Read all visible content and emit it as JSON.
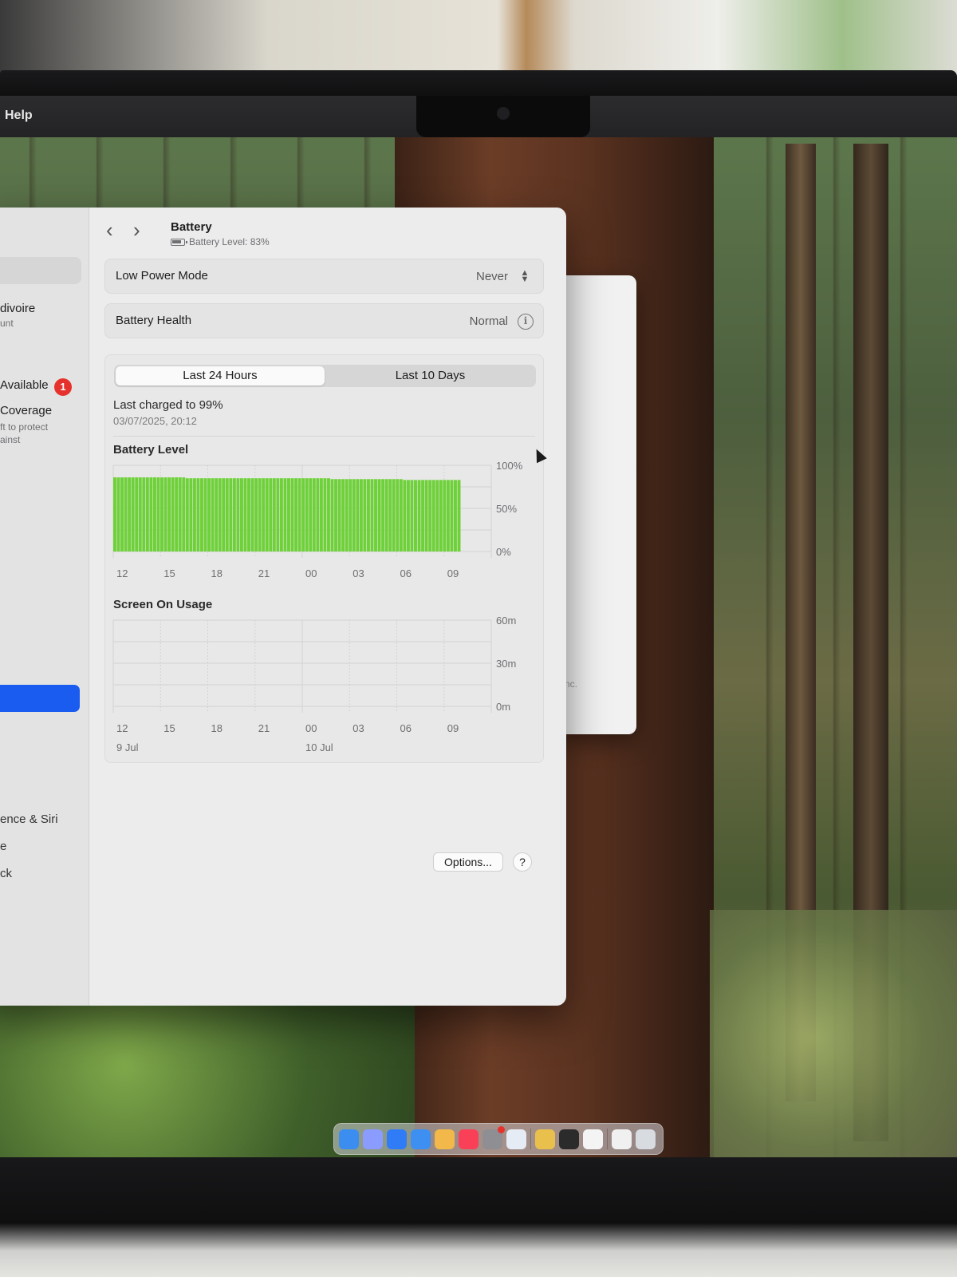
{
  "menubar": {
    "help_label": "Help"
  },
  "sidebar": {
    "items": [
      {
        "label": "divoire",
        "sub": "unt"
      },
      {
        "label": "Available",
        "badge": "1"
      },
      {
        "label": "Coverage",
        "sub1": "ft to protect",
        "sub2": "ainst"
      },
      {
        "label": "ence & Siri"
      },
      {
        "label": "e"
      },
      {
        "label": "ck"
      }
    ]
  },
  "header": {
    "back_icon": "chevron-left-icon",
    "forward_icon": "chevron-right-icon",
    "title": "Battery",
    "subtitle": "Battery Level: 83%"
  },
  "settings": {
    "low_power_mode": {
      "label": "Low Power Mode",
      "value": "Never"
    },
    "battery_health": {
      "label": "Battery Health",
      "value": "Normal"
    }
  },
  "range_tabs": {
    "tabs": [
      "Last 24 Hours",
      "Last 10 Days"
    ],
    "selected": "Last 24 Hours"
  },
  "last_charged": {
    "text": "Last charged to 99%",
    "date": "03/07/2025, 20:12"
  },
  "colors": {
    "battery_bar": "#6fd13a",
    "selected_sidebar": "#1a5cf0",
    "badge": "#e5322d"
  },
  "chart_data": [
    {
      "type": "bar",
      "title": "Battery Level",
      "x_ticks": [
        "12",
        "15",
        "18",
        "21",
        "00",
        "03",
        "06",
        "09"
      ],
      "y_ticks": [
        "100%",
        "50%",
        "0%"
      ],
      "ylim": [
        0,
        100
      ],
      "grid": true,
      "values": [
        86,
        86,
        86,
        86,
        86,
        86,
        86,
        86,
        86,
        86,
        86,
        86,
        86,
        86,
        86,
        86,
        86,
        86,
        86,
        86,
        85,
        85,
        85,
        85,
        85,
        85,
        85,
        85,
        85,
        85,
        85,
        85,
        85,
        85,
        85,
        85,
        85,
        85,
        85,
        85,
        85,
        85,
        85,
        85,
        85,
        85,
        85,
        85,
        85,
        85,
        85,
        85,
        85,
        85,
        85,
        85,
        85,
        85,
        85,
        85,
        84,
        84,
        84,
        84,
        84,
        84,
        84,
        84,
        84,
        84,
        84,
        84,
        84,
        84,
        84,
        84,
        84,
        84,
        84,
        84,
        83,
        83,
        83,
        83,
        83,
        83,
        83,
        83,
        83,
        83,
        83,
        83,
        83,
        83,
        83,
        83
      ]
    },
    {
      "type": "bar",
      "title": "Screen On Usage",
      "x_ticks": [
        "12",
        "15",
        "18",
        "21",
        "00",
        "03",
        "06",
        "09"
      ],
      "date_labels": [
        "9 Jul",
        "10 Jul"
      ],
      "y_ticks": [
        "60m",
        "30m",
        "0m"
      ],
      "ylim": [
        0,
        60
      ],
      "grid": true,
      "values": []
    }
  ],
  "footer": {
    "options_label": "Options...",
    "help_label": "?"
  },
  "background_window": {
    "fragment": "nc."
  },
  "dock": {
    "icons": [
      "finder-icon",
      "launchpad-icon",
      "safari-icon",
      "mail-icon",
      "photos-icon",
      "music-icon",
      "system-settings-icon",
      "preview-icon",
      "chrome-icon",
      "terminal-icon",
      "textedit-icon",
      "document-icon",
      "trash-icon"
    ]
  }
}
